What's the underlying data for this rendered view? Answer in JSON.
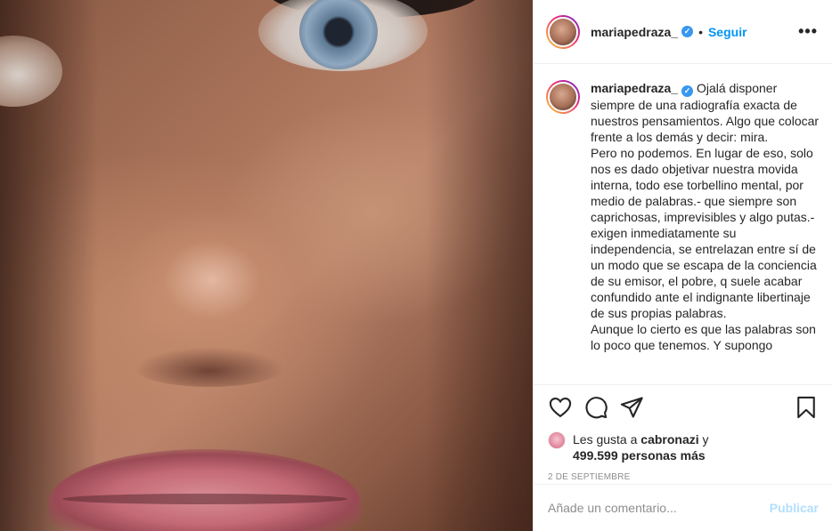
{
  "post": {
    "username": "mariapedraza_",
    "verified": true,
    "dot": "•",
    "follow_label": "Seguir",
    "more_label": "•••"
  },
  "caption": {
    "username": "mariapedraza_",
    "text": " Ojalá disponer siempre de una radiografía exacta de nuestros pensamientos. Algo que colocar frente a los demás y decir: mira.\nPero no podemos. En lugar de eso, solo nos es dado objetivar nuestra movida interna, todo ese torbellino mental, por medio de palabras.- que siempre son caprichosas, imprevisibles y algo putas.- exigen inmediatamente su independencia, se entrelazan entre sí de un modo que se escapa de la conciencia de su emisor, el pobre, q suele acabar confundido ante el indignante libertinaje de sus propias palabras.\nAunque lo cierto es que las palabras son lo poco que tenemos. Y supongo"
  },
  "actions": {
    "like_icon": "heart-icon",
    "comment_icon": "comment-icon",
    "share_icon": "paper-plane-icon",
    "save_icon": "bookmark-icon"
  },
  "likes": {
    "prefix": "Les gusta a ",
    "user": "cabronazi",
    "conj": " y",
    "count": "499.599 personas más"
  },
  "date": "2 DE SEPTIEMBRE",
  "comment": {
    "placeholder": "Añade un comentario...",
    "publish_label": "Publicar"
  },
  "colors": {
    "link_blue": "#0095f6",
    "verified_blue": "#3897f0",
    "publish_disabled": "#b2dffc"
  }
}
